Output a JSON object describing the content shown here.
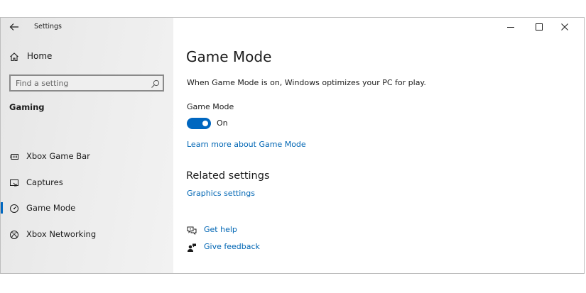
{
  "window": {
    "title": "Settings"
  },
  "sidebar": {
    "home_label": "Home",
    "search": {
      "placeholder": "Find a setting",
      "value": ""
    },
    "section_title": "Gaming",
    "items": [
      {
        "label": "Xbox Game Bar",
        "icon": "xbox-game-bar-icon",
        "selected": false
      },
      {
        "label": "Captures",
        "icon": "captures-icon",
        "selected": false
      },
      {
        "label": "Game Mode",
        "icon": "game-mode-icon",
        "selected": true
      },
      {
        "label": "Xbox Networking",
        "icon": "xbox-icon",
        "selected": false
      }
    ]
  },
  "main": {
    "title": "Game Mode",
    "description": "When Game Mode is on, Windows optimizes your PC for play.",
    "toggle": {
      "label": "Game Mode",
      "state_text": "On",
      "on": true
    },
    "learn_more": "Learn more about Game Mode",
    "related": {
      "title": "Related settings",
      "graphics_link": "Graphics settings"
    },
    "help": {
      "get_help": "Get help",
      "give_feedback": "Give feedback"
    }
  },
  "colors": {
    "accent": "#0067c0",
    "link": "#0066b4",
    "sidebar_bg": "#e9e9e9"
  }
}
